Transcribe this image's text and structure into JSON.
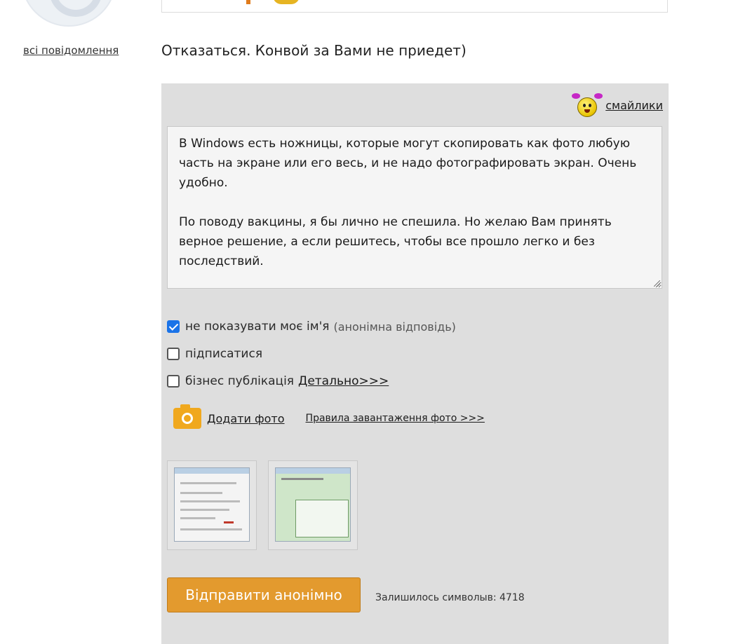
{
  "sidebar": {
    "all_messages_link": "всі повідомлення"
  },
  "post": {
    "text": "Отказаться. Конвой за Вами не приедет)"
  },
  "reply": {
    "smileys_label": "смайлики",
    "smileys_icon": "smiley-icon",
    "textarea_value": "В Windows есть ножницы, которые могут скопировать как фото любую часть на экране или его весь, и не надо фотографировать экран. Очень удобно.\n\nПо поводу вакцины, я бы лично не спешила. Но желаю Вам принять верное решение, а если решитесь, чтобы все прошло легко и без последствий.",
    "options": {
      "anonymous": {
        "label": "не показувати моє ім'я",
        "note": "(анонімна відповідь)",
        "checked": true
      },
      "subscribe": {
        "label": "підписатися",
        "checked": false
      },
      "business": {
        "label": "бізнес публікація",
        "link": "Детально>>>",
        "checked": false
      }
    },
    "photo": {
      "icon": "camera-icon",
      "add_label": "Додати фото",
      "rules_link": "Правила завантаження фото >>>"
    },
    "send_button": "Відправити анонімно",
    "chars_left": "Залишилось символыв: 4718"
  },
  "colors": {
    "panel_bg": "#dedede",
    "button_bg": "#e39a2e",
    "checkbox_checked": "#1a73e8",
    "camera": "#f0a81e"
  }
}
